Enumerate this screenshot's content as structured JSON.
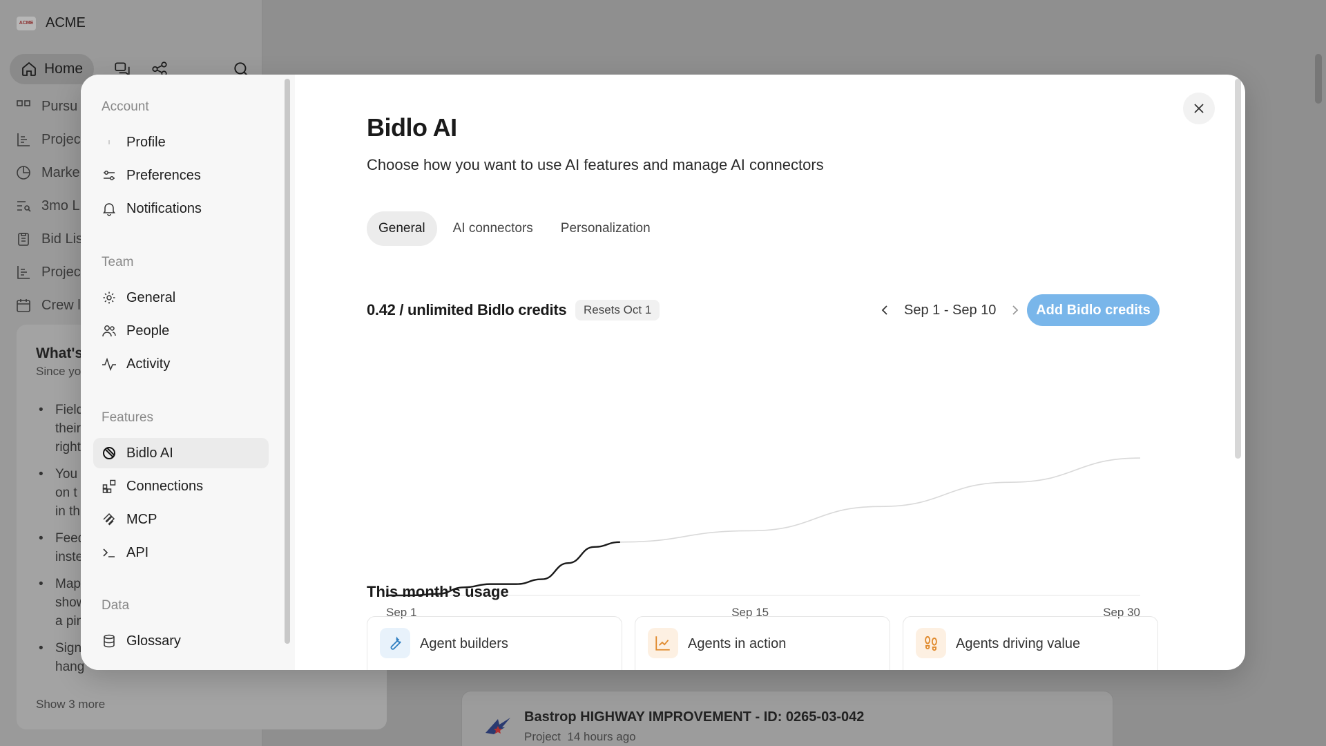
{
  "app": {
    "brand_name": "ACME",
    "brand_logo_text": "ACME",
    "home_label": "Home",
    "nav_items": [
      "Pursu",
      "Projec",
      "Marke",
      "3mo L",
      "Bid Lis",
      "Projec",
      "Crew l"
    ],
    "whats_new": {
      "title": "What's",
      "subtitle": "Since yo",
      "items": [
        {
          "lines": [
            "Field",
            "their",
            "right"
          ]
        },
        {
          "lines": [
            "You",
            "on t",
            "in th"
          ]
        },
        {
          "lines": [
            "Feed",
            "inste"
          ]
        },
        {
          "lines": [
            "Map",
            "show",
            "a pin"
          ]
        },
        {
          "lines": [
            "Signi",
            "hang"
          ]
        }
      ],
      "show_more": "Show 3 more"
    },
    "project_card": {
      "title": "Bastrop HIGHWAY IMPROVEMENT - ID: 0265-03-042",
      "type": "Project",
      "time": "14 hours ago"
    }
  },
  "settings_nav": {
    "sections": [
      {
        "label": "Account",
        "items": [
          {
            "label": "Profile",
            "icon": "profile-icon"
          },
          {
            "label": "Preferences",
            "icon": "sliders-icon"
          },
          {
            "label": "Notifications",
            "icon": "bell-icon"
          }
        ]
      },
      {
        "label": "Team",
        "items": [
          {
            "label": "General",
            "icon": "gear-icon"
          },
          {
            "label": "People",
            "icon": "people-icon"
          },
          {
            "label": "Activity",
            "icon": "activity-icon"
          }
        ]
      },
      {
        "label": "Features",
        "items": [
          {
            "label": "Bidlo AI",
            "icon": "bidlo-ai-icon",
            "active": true
          },
          {
            "label": "Connections",
            "icon": "connections-icon"
          },
          {
            "label": "MCP",
            "icon": "mcp-icon"
          },
          {
            "label": "API",
            "icon": "terminal-icon"
          }
        ]
      },
      {
        "label": "Data",
        "items": [
          {
            "label": "Glossary",
            "icon": "database-icon"
          }
        ]
      }
    ]
  },
  "main": {
    "title": "Bidlo AI",
    "subtitle": "Choose how you want to use AI features and manage AI connectors",
    "tabs": [
      {
        "label": "General",
        "active": true
      },
      {
        "label": "AI connectors"
      },
      {
        "label": "Personalization"
      }
    ],
    "credits": {
      "usage_text": "0.42 / unlimited Bidlo credits",
      "resets_badge": "Resets Oct 1",
      "date_range": "Sep 1 - Sep 10",
      "add_button": "Add Bidlo credits"
    },
    "usage": {
      "title": "This month's usage",
      "cards": [
        {
          "label": "Agent builders",
          "icon": "wrench-icon",
          "color": "#2f7fc1",
          "bg": "#e8f2fb"
        },
        {
          "label": "Agents in action",
          "icon": "chart-icon",
          "color": "#e08a2d",
          "bg": "#fdf0e2"
        },
        {
          "label": "Agents driving value",
          "icon": "footprints-icon",
          "color": "#e08a2d",
          "bg": "#fdf0e2"
        }
      ]
    }
  },
  "colors": {
    "accent_button": "#79b6ea",
    "actual_line": "#1a1a1a",
    "projected_line": "#d9d9d9"
  },
  "chart_data": {
    "type": "line",
    "x_ticks": [
      "Sep 1",
      "Sep 15",
      "Sep 30"
    ],
    "xlim": [
      1,
      30
    ],
    "series": [
      {
        "values": [
          [
            1,
            0.0
          ],
          [
            2,
            0.0
          ],
          [
            3,
            0.01
          ],
          [
            4,
            0.05
          ],
          [
            5,
            0.07
          ],
          [
            6,
            0.07
          ],
          [
            7,
            0.1
          ],
          [
            8,
            0.2
          ],
          [
            9,
            0.3
          ],
          [
            10,
            0.33
          ]
        ]
      },
      {
        "values": [
          [
            10,
            0.33
          ],
          [
            15,
            0.4
          ],
          [
            20,
            0.55
          ],
          [
            25,
            0.7
          ],
          [
            30,
            0.85
          ]
        ]
      }
    ],
    "ylim": [
      0,
      1
    ]
  }
}
